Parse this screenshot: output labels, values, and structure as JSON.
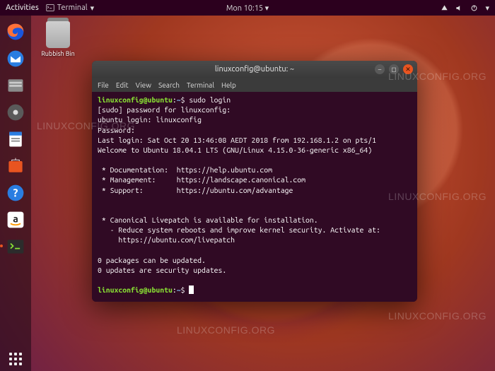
{
  "topbar": {
    "activities": "Activities",
    "app": "Terminal",
    "clock": "Mon 10:15"
  },
  "desktop": {
    "trash_label": "Rubbish Bin"
  },
  "window": {
    "title": "linuxconfig@ubuntu: ~",
    "menu": {
      "file": "File",
      "edit": "Edit",
      "view": "View",
      "search": "Search",
      "terminal": "Terminal",
      "help": "Help"
    }
  },
  "term": {
    "prompt_user": "linuxconfig@ubuntu",
    "prompt_path": "~",
    "cmd1": "sudo login",
    "l2": "[sudo] password for linuxconfig:",
    "l3": "ubuntu login: linuxconfig",
    "l4": "Password:",
    "l5": "Last login: Sat Oct 20 13:46:08 AEDT 2018 from 192.168.1.2 on pts/1",
    "l6": "Welcome to Ubuntu 18.04.1 LTS (GNU/Linux 4.15.0-36-generic x86_64)",
    "doc": " * Documentation:  https://help.ubuntu.com",
    "mgmt": " * Management:     https://landscape.canonical.com",
    "sup": " * Support:        https://ubuntu.com/advantage",
    "lp1": " * Canonical Livepatch is available for installation.",
    "lp2": "   - Reduce system reboots and improve kernel security. Activate at:",
    "lp3": "     https://ubuntu.com/livepatch",
    "pk1": "0 packages can be updated.",
    "pk2": "0 updates are security updates."
  },
  "watermark": "LINUXCONFIG.ORG"
}
